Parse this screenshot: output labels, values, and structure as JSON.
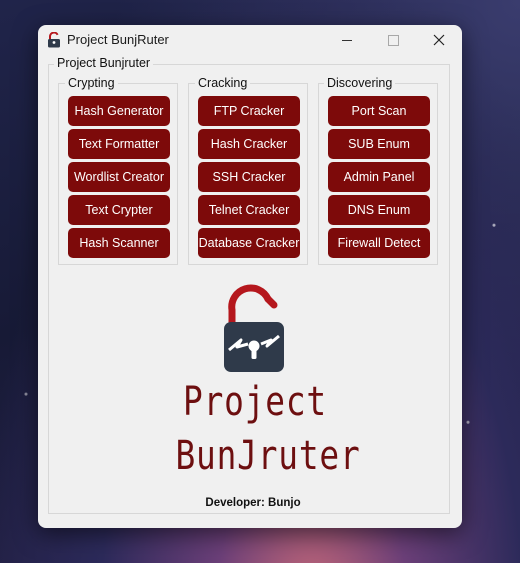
{
  "window": {
    "title": "Project BunjRuter",
    "app_icon": "lock-icon"
  },
  "main_group": {
    "label": "Project Bunjruter"
  },
  "groups": [
    {
      "label": "Crypting",
      "buttons": [
        "Hash Generator",
        "Text Formatter",
        "Wordlist Creator",
        "Text Crypter",
        "Hash Scanner"
      ]
    },
    {
      "label": "Cracking",
      "buttons": [
        "FTP Cracker",
        "Hash Cracker",
        "SSH Cracker",
        "Telnet Cracker",
        "Database Cracker"
      ]
    },
    {
      "label": "Discovering",
      "buttons": [
        "Port Scan",
        "SUB Enum",
        "Admin Panel",
        "DNS Enum",
        "Firewall Detect"
      ]
    }
  ],
  "logo": {
    "line1": "Project",
    "line2": "BunJruter",
    "icon": "broken-padlock-icon"
  },
  "developer": "Developer: Bunjo",
  "colors": {
    "button_bg": "#7d0a0a",
    "logo_dark": "#2f3a4a",
    "logo_red": "#b5171d",
    "logo_text": "#6d0f10"
  }
}
